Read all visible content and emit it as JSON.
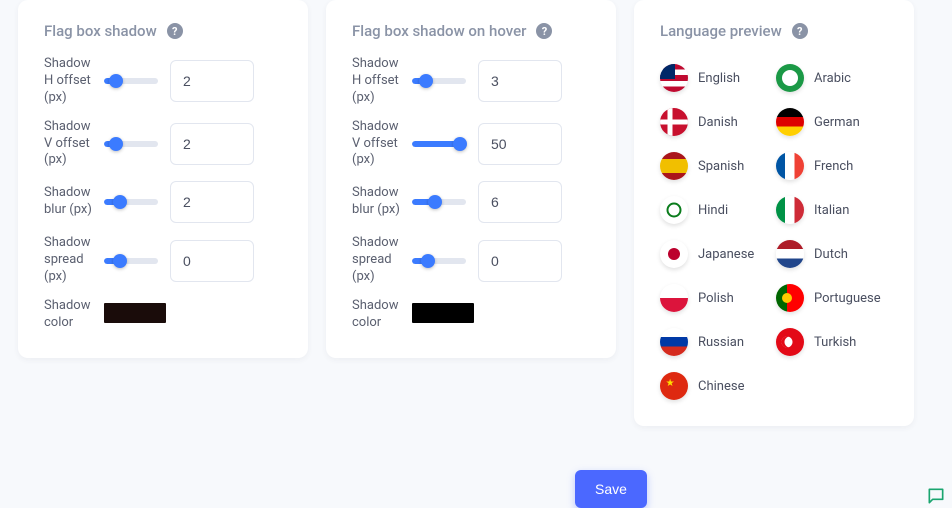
{
  "card_shadow": {
    "title": "Flag box shadow",
    "fields": {
      "h_offset": {
        "label": "Shadow H offset (px)",
        "value": "2",
        "pct": 22
      },
      "v_offset": {
        "label": "Shadow V offset (px)",
        "value": "2",
        "pct": 22
      },
      "blur": {
        "label": "Shadow blur (px)",
        "value": "2",
        "pct": 30
      },
      "spread": {
        "label": "Shadow spread (px)",
        "value": "0",
        "pct": 30
      },
      "color": {
        "label": "Shadow color",
        "hex": "#1a0c0a"
      }
    }
  },
  "card_hover": {
    "title": "Flag box shadow on hover",
    "fields": {
      "h_offset": {
        "label": "Shadow H offset (px)",
        "value": "3",
        "pct": 25
      },
      "v_offset": {
        "label": "Shadow V offset (px)",
        "value": "50",
        "pct": 88
      },
      "blur": {
        "label": "Shadow blur (px)",
        "value": "6",
        "pct": 42
      },
      "spread": {
        "label": "Shadow spread (px)",
        "value": "0",
        "pct": 30
      },
      "color": {
        "label": "Shadow color",
        "hex": "#000000"
      }
    }
  },
  "preview": {
    "title": "Language preview",
    "items": [
      {
        "label": "English",
        "code": "us"
      },
      {
        "label": "Arabic",
        "code": "ar"
      },
      {
        "label": "Danish",
        "code": "dk"
      },
      {
        "label": "German",
        "code": "de"
      },
      {
        "label": "Spanish",
        "code": "es"
      },
      {
        "label": "French",
        "code": "fr"
      },
      {
        "label": "Hindi",
        "code": "in"
      },
      {
        "label": "Italian",
        "code": "it"
      },
      {
        "label": "Japanese",
        "code": "jp"
      },
      {
        "label": "Dutch",
        "code": "nl"
      },
      {
        "label": "Polish",
        "code": "pl"
      },
      {
        "label": "Portuguese",
        "code": "pt"
      },
      {
        "label": "Russian",
        "code": "ru"
      },
      {
        "label": "Turkish",
        "code": "tr"
      },
      {
        "label": "Chinese",
        "code": "cn"
      }
    ]
  },
  "save_label": "Save"
}
